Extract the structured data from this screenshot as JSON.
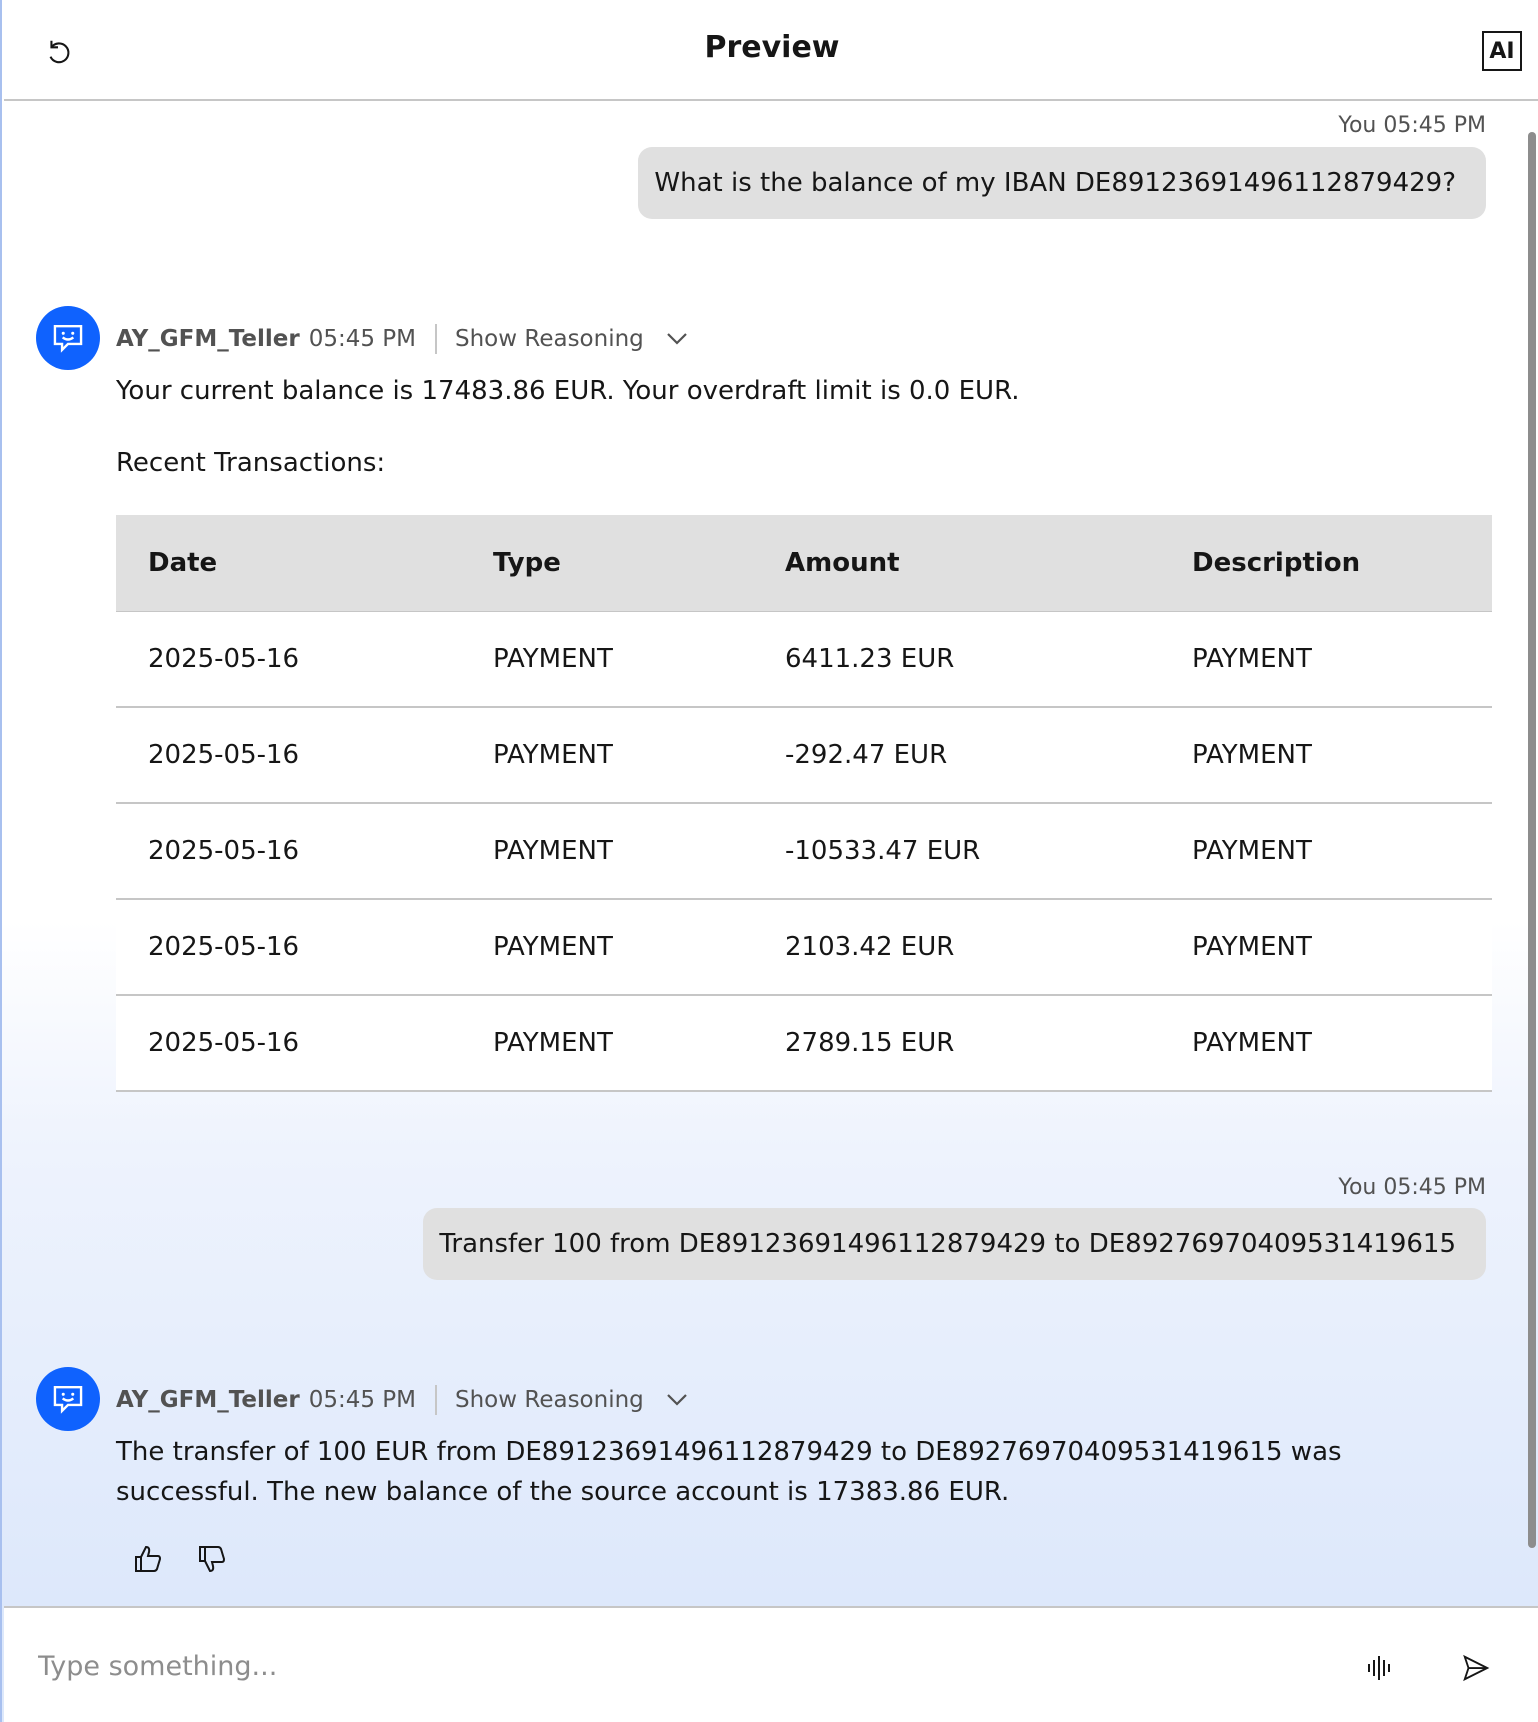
{
  "header": {
    "title": "Preview",
    "ai_badge": "AI"
  },
  "messages": [
    {
      "sender": "You",
      "time": "05:45 PM",
      "text": "What is the balance of my IBAN DE89123691496112879429?"
    },
    {
      "sender": "AY_GFM_Teller",
      "time": "05:45 PM",
      "reasoning_label": "Show Reasoning",
      "line1": "Your current balance is 17483.86 EUR. Your overdraft limit is 0.0 EUR.",
      "line2": "Recent Transactions:",
      "table": {
        "headers": [
          "Date",
          "Type",
          "Amount",
          "Description"
        ],
        "rows": [
          [
            "2025-05-16",
            "PAYMENT",
            "6411.23 EUR",
            "PAYMENT"
          ],
          [
            "2025-05-16",
            "PAYMENT",
            "-292.47 EUR",
            "PAYMENT"
          ],
          [
            "2025-05-16",
            "PAYMENT",
            "-10533.47 EUR",
            "PAYMENT"
          ],
          [
            "2025-05-16",
            "PAYMENT",
            "2103.42 EUR",
            "PAYMENT"
          ],
          [
            "2025-05-16",
            "PAYMENT",
            "2789.15 EUR",
            "PAYMENT"
          ]
        ]
      }
    },
    {
      "sender": "You",
      "time": "05:45 PM",
      "text": "Transfer 100 from DE89123691496112879429 to DE89276970409531419615"
    },
    {
      "sender": "AY_GFM_Teller",
      "time": "05:45 PM",
      "reasoning_label": "Show Reasoning",
      "line1": "The transfer of 100 EUR from DE89123691496112879429 to DE89276970409531419615 was",
      "line2": "successful. The new balance of the source account is 17383.86 EUR."
    }
  ],
  "input": {
    "placeholder": "Type something..."
  },
  "icons": {
    "restart": "restart-icon",
    "avatar": "chat-bot-icon",
    "chevron": "chevron-down-icon",
    "thumbs_up": "thumbs-up-icon",
    "thumbs_down": "thumbs-down-icon",
    "voice": "microphone-waveform-icon",
    "send": "send-icon"
  },
  "colors": {
    "accent": "#0f62fe",
    "bubble": "#e0e0e0",
    "table_header": "#e0e0e0"
  }
}
